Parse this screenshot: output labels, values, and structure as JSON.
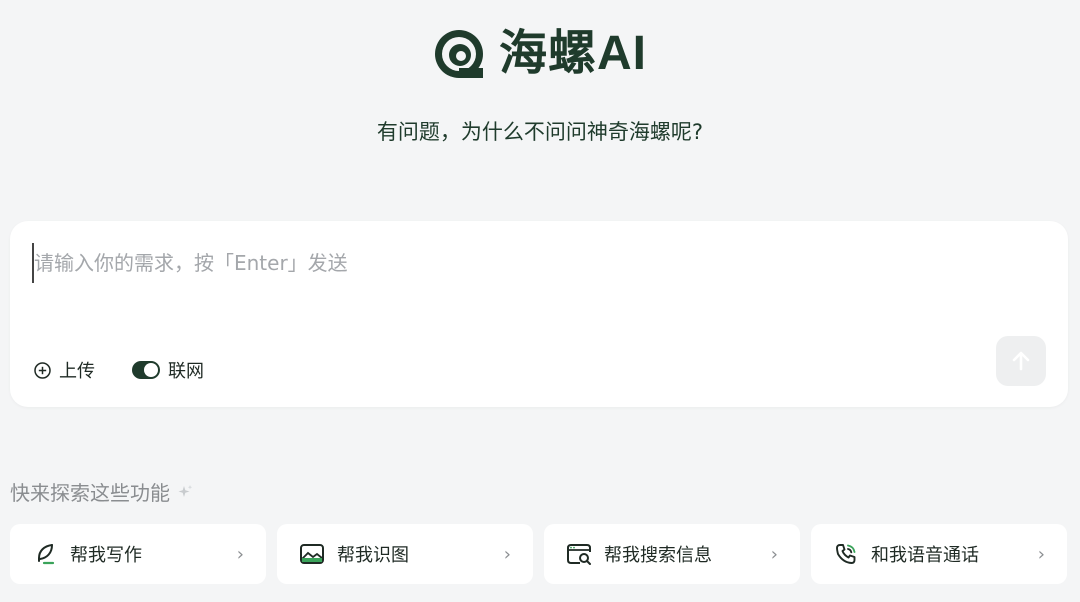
{
  "brand": {
    "name": "海螺AI",
    "tagline": "有问题，为什么不问问神奇海螺呢?",
    "color": "#1f3b2c"
  },
  "composer": {
    "placeholder": "请输入你的需求，按「Enter」发送",
    "value": "",
    "upload_label": "上传",
    "web_label": "联网",
    "web_enabled": true,
    "send_icon": "arrow-up-icon"
  },
  "explore": {
    "title": "快来探索这些功能",
    "sparkle_icon": "sparkle-icon"
  },
  "features": [
    {
      "label": "帮我写作",
      "icon": "leaf-pen-icon"
    },
    {
      "label": "帮我识图",
      "icon": "image-icon"
    },
    {
      "label": "帮我搜索信息",
      "icon": "browser-search-icon"
    },
    {
      "label": "和我语音通话",
      "icon": "phone-call-icon"
    }
  ]
}
